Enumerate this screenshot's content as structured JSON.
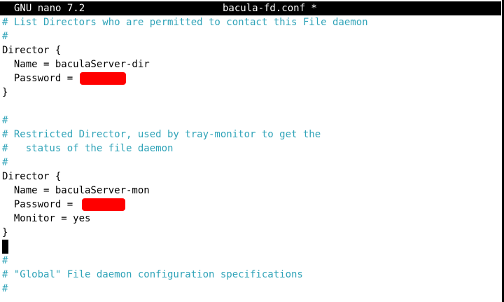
{
  "titlebar": {
    "app": "GNU nano 7.2",
    "filename": "bacula-fd.conf *"
  },
  "lines": [
    "# List Directors who are permitted to contact this File daemon",
    "#",
    "Director {",
    "  Name = baculaServer-dir",
    "  Password = ",
    "}",
    "",
    "#",
    "# Restricted Director, used by tray-monitor to get the",
    "#   status of the file daemon",
    "#",
    "Director {",
    "  Name = baculaServer-mon",
    "  Password = ",
    "  Monitor = yes",
    "}",
    "",
    "#",
    "# \"Global\" File daemon configuration specifications",
    "#"
  ],
  "colors": {
    "comment": "#2fa3b8",
    "redaction": "#ff0000",
    "titlebar_bg": "#000000"
  }
}
